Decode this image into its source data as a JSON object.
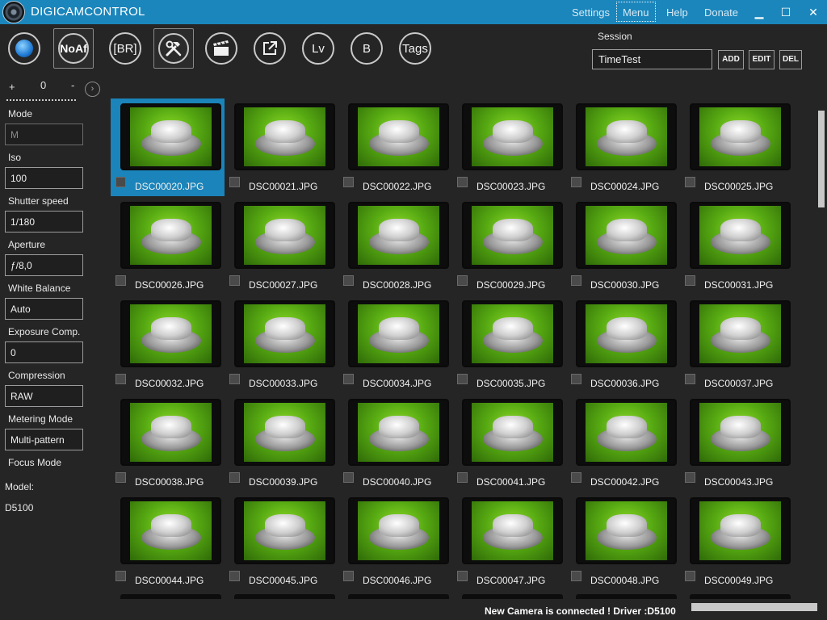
{
  "app": {
    "title": "DIGICAMCONTROL"
  },
  "titlebar": {
    "menus": [
      "Settings",
      "Menu",
      "Help",
      "Donate"
    ],
    "minimize": "▁",
    "maximize": "☐",
    "close": "✕"
  },
  "toolbar": {
    "capture_icon": "capture-icon",
    "noaf_label": "NoAf",
    "br_label": "[BR]",
    "tools_icon": "hammer-wrench-icon",
    "movie_icon": "clapperboard-icon",
    "export_icon": "external-link-icon",
    "lv_label": "Lv",
    "b_label": "B",
    "tags_label": "Tags"
  },
  "session": {
    "label": "Session",
    "value": "TimeTest",
    "add": "ADD",
    "edit": "EDIT",
    "del": "DEL"
  },
  "exposure_scale": {
    "plus": "+",
    "zero": "0",
    "minus": "-",
    "arrow": "›"
  },
  "camera": {
    "mode_label": "Mode",
    "mode": "M",
    "iso_label": "Iso",
    "iso": "100",
    "shutter_label": "Shutter speed",
    "shutter": "1/180",
    "aperture_label": "Aperture",
    "aperture": "ƒ/8,0",
    "wb_label": "White Balance",
    "wb": "Auto",
    "exp_label": "Exposure Comp.",
    "exp": "0",
    "compression_label": "Compression",
    "compression": "RAW",
    "metering_label": "Metering Mode",
    "metering": "Multi-pattern",
    "focus_label": "Focus Mode",
    "model_label": "Model:",
    "model": "D5100"
  },
  "gallery": {
    "files": [
      "DSC00020.JPG",
      "DSC00021.JPG",
      "DSC00022.JPG",
      "DSC00023.JPG",
      "DSC00024.JPG",
      "DSC00025.JPG",
      "DSC00026.JPG",
      "DSC00027.JPG",
      "DSC00028.JPG",
      "DSC00029.JPG",
      "DSC00030.JPG",
      "DSC00031.JPG",
      "DSC00032.JPG",
      "DSC00033.JPG",
      "DSC00034.JPG",
      "DSC00035.JPG",
      "DSC00036.JPG",
      "DSC00037.JPG",
      "DSC00038.JPG",
      "DSC00039.JPG",
      "DSC00040.JPG",
      "DSC00041.JPG",
      "DSC00042.JPG",
      "DSC00043.JPG",
      "DSC00044.JPG",
      "DSC00045.JPG",
      "DSC00046.JPG",
      "DSC00047.JPG",
      "DSC00048.JPG",
      "DSC00049.JPG"
    ],
    "selected_index": 0
  },
  "status": {
    "message": "New Camera is connected ! Driver :D5100"
  },
  "colors": {
    "accent": "#1b86bc",
    "background": "#252526"
  }
}
